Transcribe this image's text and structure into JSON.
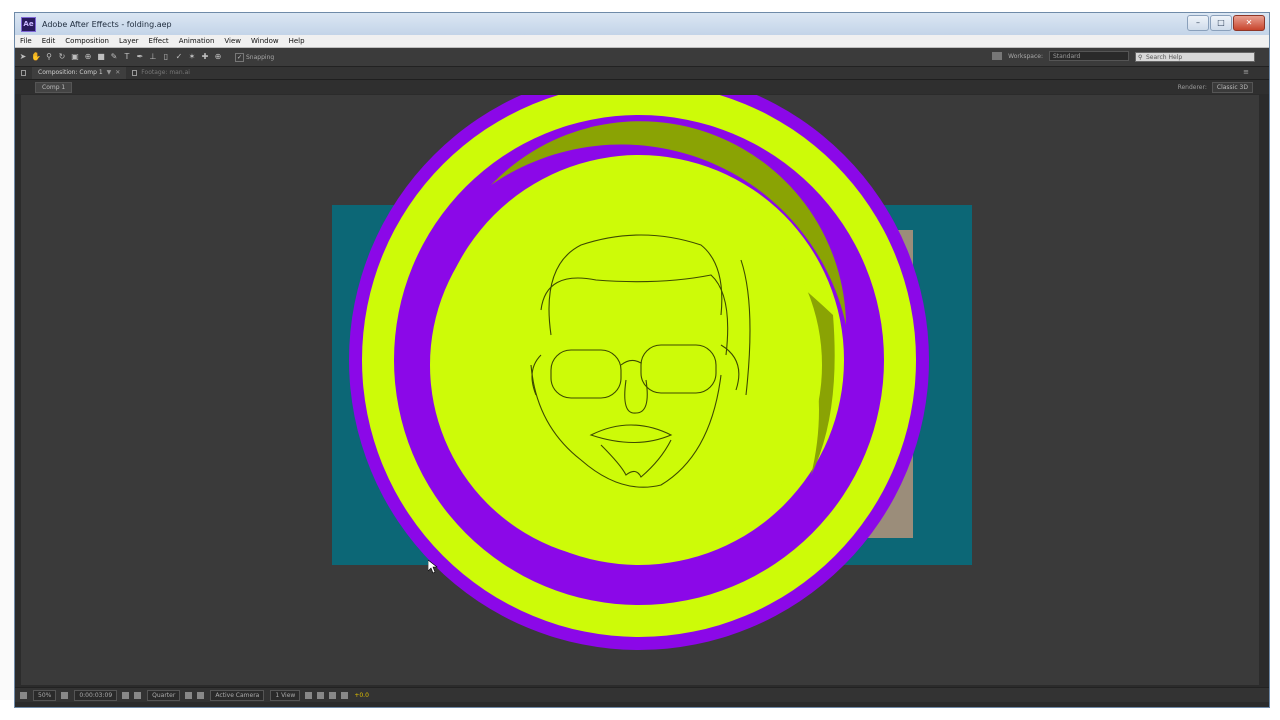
{
  "window": {
    "title": "Adobe After Effects - folding.aep",
    "app_icon": "Ae"
  },
  "menu": [
    "File",
    "Edit",
    "Composition",
    "Layer",
    "Effect",
    "Animation",
    "View",
    "Window",
    "Help"
  ],
  "toolbar": {
    "snapping_label": "Snapping",
    "workspace_label": "Workspace:",
    "workspace_value": "Standard",
    "search_placeholder": "Search Help"
  },
  "tabs": [
    {
      "label": "Composition: Comp 1"
    },
    {
      "label": "Footage: man.ai"
    }
  ],
  "comp": {
    "breadcrumb": "Comp 1",
    "renderer_label": "Renderer:",
    "renderer_value": "Classic 3D"
  },
  "viewer_bar": {
    "zoom": "50%",
    "timecode": "0:00:03:09",
    "resolution": "Quarter",
    "camera": "Active Camera",
    "views": "1 View",
    "exposure": "+0.0"
  },
  "colors": {
    "background": "#3a3a3a",
    "teal": "#0c6776",
    "purple": "#8b08e8",
    "lime": "#cdfb08",
    "olive": "#8aa304",
    "beige": "#9b8d7a"
  }
}
